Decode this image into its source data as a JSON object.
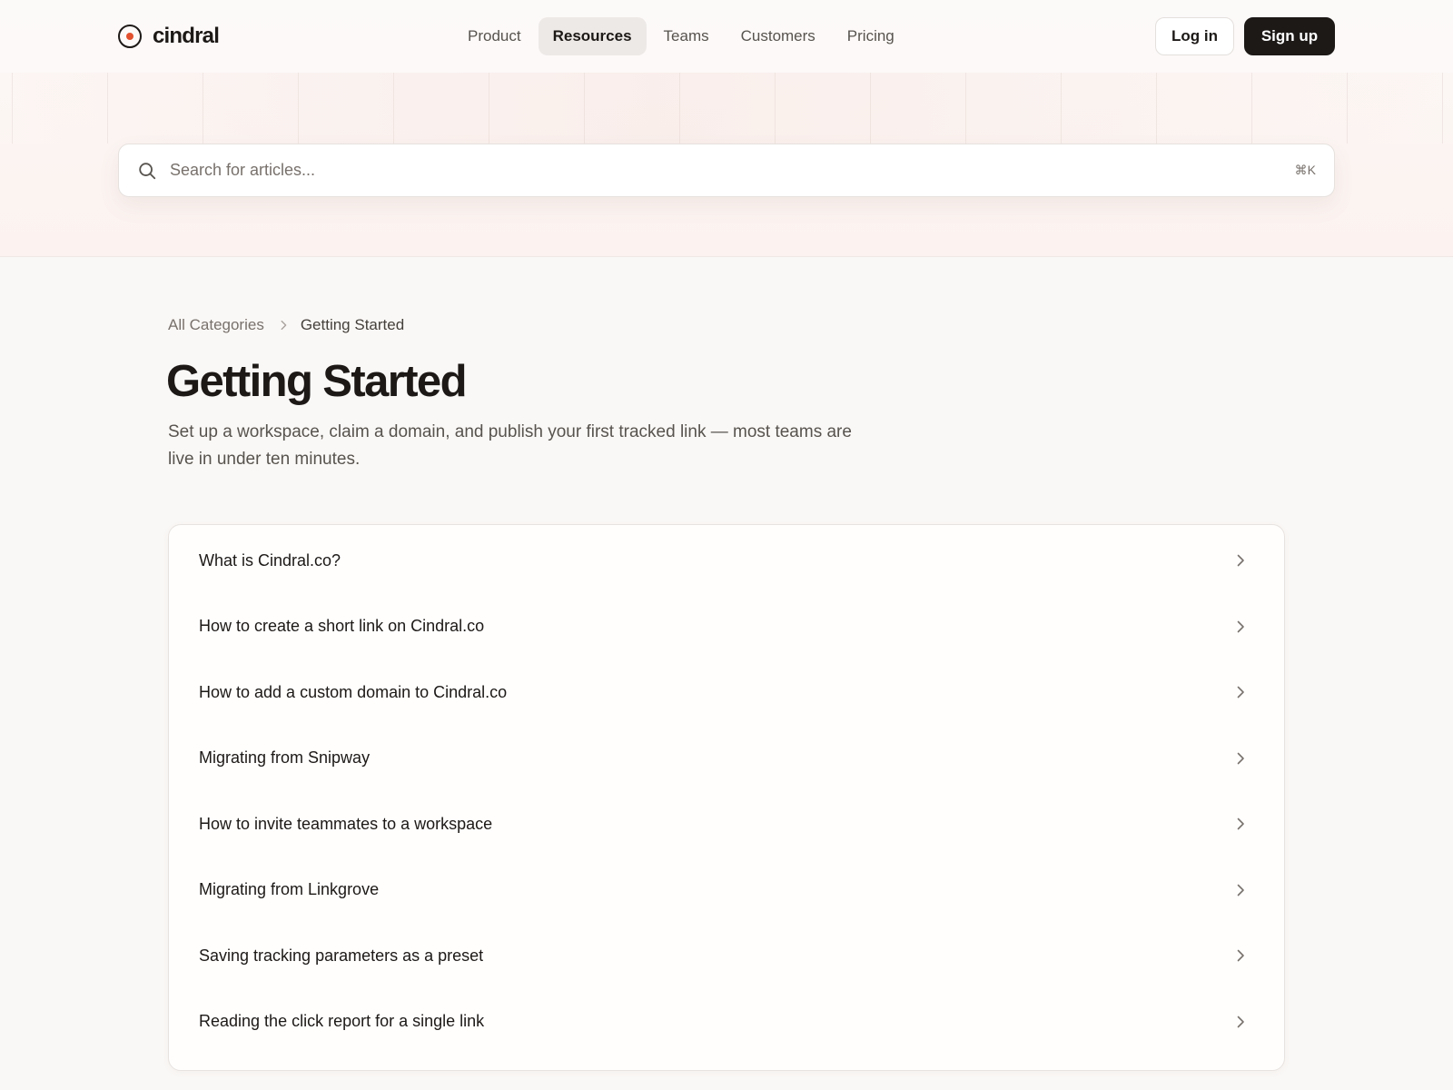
{
  "brand": {
    "name": "cindral"
  },
  "nav": {
    "items": [
      {
        "label": "Product"
      },
      {
        "label": "Resources"
      },
      {
        "label": "Teams"
      },
      {
        "label": "Customers"
      },
      {
        "label": "Pricing"
      }
    ],
    "active": "Resources",
    "login_label": "Log in",
    "signup_label": "Sign up"
  },
  "search": {
    "placeholder": "Search for articles...",
    "value": "",
    "shortcut": "⌘K"
  },
  "breadcrumb": {
    "root": "All Categories",
    "current": "Getting Started"
  },
  "page": {
    "title": "Getting Started",
    "description": "Set up a workspace, claim a domain, and publish your first tracked link — most teams are live in under ten minutes."
  },
  "articles": [
    {
      "title": "What is Cindral.co?"
    },
    {
      "title": "How to create a short link on Cindral.co"
    },
    {
      "title": "How to add a custom domain to Cindral.co"
    },
    {
      "title": "Migrating from Snipway"
    },
    {
      "title": "How to invite teammates to a workspace"
    },
    {
      "title": "Migrating from Linkgrove"
    },
    {
      "title": "Saving tracking parameters as a preset"
    },
    {
      "title": "Reading the click report for a single link"
    }
  ],
  "icons": {
    "search": "search-icon",
    "breadcrumb_separator": "chevron-right-icon",
    "row_arrow": "chevron-right-icon",
    "logo": "logo-ring-icon"
  },
  "colors": {
    "accent": "#e2502e",
    "primary_button": "#1c1917"
  }
}
